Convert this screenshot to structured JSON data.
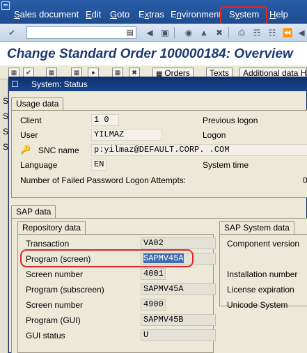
{
  "menubar": {
    "items": [
      {
        "label": "Sales document",
        "underline": "S",
        "rest": "ales document"
      },
      {
        "label": "Edit",
        "underline": "E",
        "rest": "dit"
      },
      {
        "label": "Goto",
        "underline": "G",
        "rest": "oto"
      },
      {
        "label": "Extras",
        "underline": "x",
        "prefix": "E",
        "rest": "tras"
      },
      {
        "label": "Environment",
        "underline": "n",
        "prefix": "E",
        "rest": "vironment"
      },
      {
        "label": "System",
        "underline": "y",
        "prefix": "S",
        "rest": "stem"
      },
      {
        "label": "Help",
        "underline": "H",
        "rest": "elp"
      }
    ]
  },
  "toolbar": {
    "command_value": ""
  },
  "title": "Change Standard Order 100000184: Overview",
  "app_toolbar": {
    "orders_label": "Orders",
    "texts_label": "Texts",
    "additional_label": "Additional data H"
  },
  "left_strip": [
    "S",
    "S",
    "S",
    "S"
  ],
  "dialog": {
    "title": "System: Status",
    "usage": {
      "tab": "Usage data",
      "client_label": "Client",
      "client_value": "1 0",
      "user_label": "User",
      "user_value": "YILMAZ",
      "snc_label": "SNC name",
      "snc_value": "p:yilmaz@DEFAULT.CORP. .COM",
      "language_label": "Language",
      "language_value": "EN",
      "failed_label": "Number of Failed Password Logon Attempts:",
      "failed_value": "0",
      "previous_logon_label": "Previous logon",
      "logon_label": "Logon",
      "system_time_label": "System time"
    },
    "sap": {
      "tab": "SAP data",
      "repo_tab": "Repository data",
      "transaction_label": "Transaction",
      "transaction_value": "VA02",
      "program_screen_label": "Program (screen)",
      "program_screen_value": "SAPMV45A",
      "screen_number_label": "Screen number",
      "screen_number_value": "4001",
      "program_subscreen_label": "Program (subscreen)",
      "program_subscreen_value": "SAPMV45A",
      "screen_number2_label": "Screen number",
      "screen_number2_value": "4900",
      "program_gui_label": "Program (GUI)",
      "program_gui_value": "SAPMV45B",
      "gui_status_label": "GUI status",
      "gui_status_value": "U",
      "system_tab": "SAP System data",
      "component_label": "Component version",
      "installation_label": "Installation number",
      "license_label": "License expiration",
      "unicode_label": "Unicode System"
    }
  }
}
